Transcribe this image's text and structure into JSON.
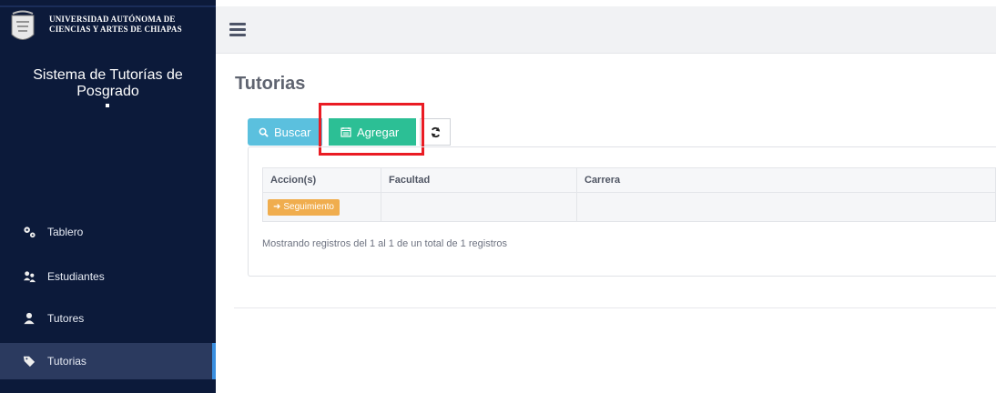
{
  "university": {
    "line1": "Universidad Autónoma de",
    "line2": "Ciencias y Artes de Chiapas"
  },
  "system_title": "Sistema de Tutorías de Posgrado",
  "nav": [
    {
      "label": "Tablero",
      "icon": "gears-icon"
    },
    {
      "label": "Estudiantes",
      "icon": "users-icon"
    },
    {
      "label": "Tutores",
      "icon": "user-icon"
    },
    {
      "label": "Tutorias",
      "icon": "tag-icon",
      "active": true
    }
  ],
  "page_title": "Tutorias",
  "toolbar": {
    "search_label": "Buscar",
    "add_label": "Agregar"
  },
  "table": {
    "headers": [
      "Accion(s)",
      "Facultad",
      "Carrera"
    ],
    "rows": [
      {
        "action": "Seguimiento",
        "facultad": "",
        "carrera": ""
      }
    ]
  },
  "pagination_info": "Mostrando registros del 1 al 1 de un total de 1 registros",
  "colors": {
    "sidebar": "#0c1a3a",
    "search": "#5bc0de",
    "add": "#2cbf95",
    "action": "#f0ad4e",
    "highlight": "#ea1c24"
  }
}
